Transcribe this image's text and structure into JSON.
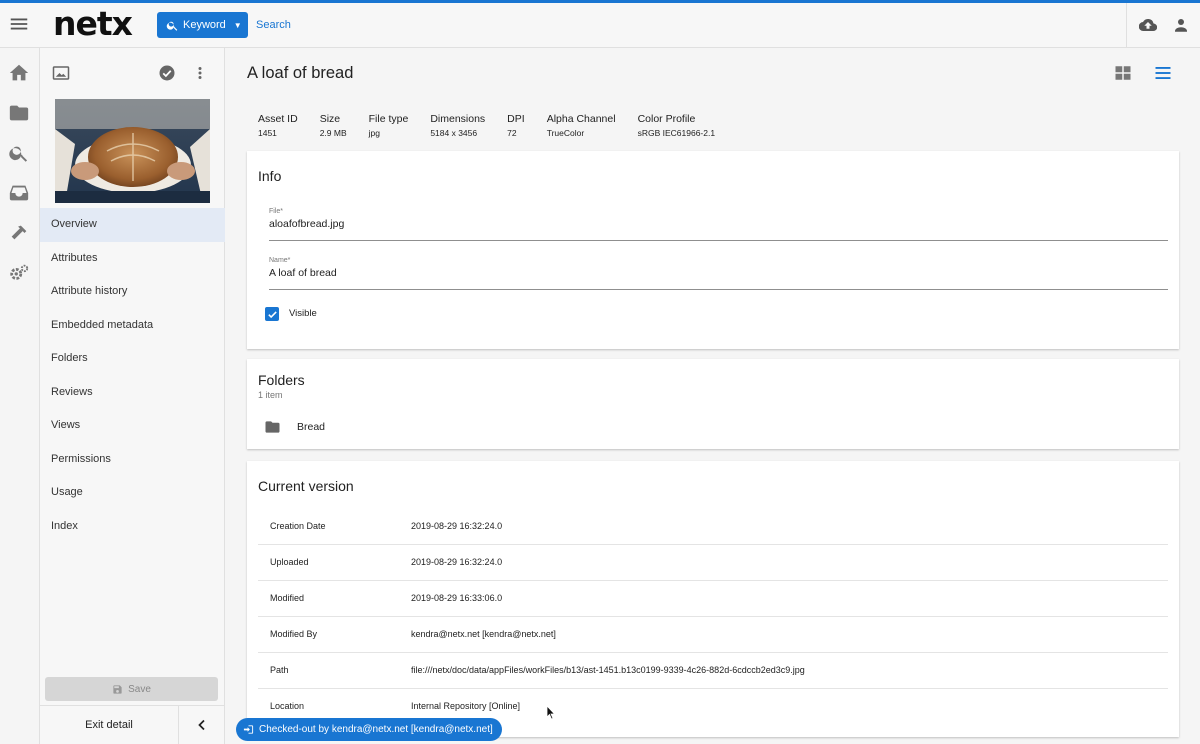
{
  "header": {
    "logo": "netx",
    "search_mode_label": "Keyword",
    "search_placeholder": "Search"
  },
  "asset": {
    "title": "A loaf of bread",
    "meta": [
      {
        "label": "Asset ID",
        "value": "1451"
      },
      {
        "label": "Size",
        "value": "2.9 MB"
      },
      {
        "label": "File type",
        "value": "jpg"
      },
      {
        "label": "Dimensions",
        "value": "5184 x 3456"
      },
      {
        "label": "DPI",
        "value": "72"
      },
      {
        "label": "Alpha Channel",
        "value": "TrueColor"
      },
      {
        "label": "Color Profile",
        "value": "sRGB IEC61966-2.1"
      }
    ]
  },
  "sidebar": {
    "nav": [
      {
        "label": "Overview",
        "active": true
      },
      {
        "label": "Attributes"
      },
      {
        "label": "Attribute history"
      },
      {
        "label": "Embedded metadata"
      },
      {
        "label": "Folders"
      },
      {
        "label": "Reviews"
      },
      {
        "label": "Views"
      },
      {
        "label": "Permissions"
      },
      {
        "label": "Usage"
      },
      {
        "label": "Index"
      }
    ],
    "save_label": "Save",
    "exit_label": "Exit detail"
  },
  "info": {
    "title": "Info",
    "file_label": "File*",
    "file_value": "aloafofbread.jpg",
    "name_label": "Name*",
    "name_value": "A loaf of bread",
    "visible_label": "Visible",
    "visible_checked": true
  },
  "folders": {
    "title": "Folders",
    "count": "1 item",
    "items": [
      {
        "name": "Bread"
      }
    ]
  },
  "version": {
    "title": "Current version",
    "rows": [
      {
        "label": "Creation Date",
        "value": "2019-08-29 16:32:24.0"
      },
      {
        "label": "Uploaded",
        "value": "2019-08-29 16:32:24.0"
      },
      {
        "label": "Modified",
        "value": "2019-08-29 16:33:06.0"
      },
      {
        "label": "Modified By",
        "value": "kendra@netx.net [kendra@netx.net]"
      },
      {
        "label": "Path",
        "value": "file:///netx/doc/data/appFiles/workFiles/b13/ast-1451.b13c0199-9339-4c26-882d-6cdccb2ed3c9.jpg"
      },
      {
        "label": "Location",
        "value": "Internal Repository [Online]"
      }
    ]
  },
  "status": {
    "checked_out": "Checked-out by kendra@netx.net [kendra@netx.net]"
  },
  "colors": {
    "accent": "#1976d2",
    "nav_active": "#e3eaf5"
  }
}
